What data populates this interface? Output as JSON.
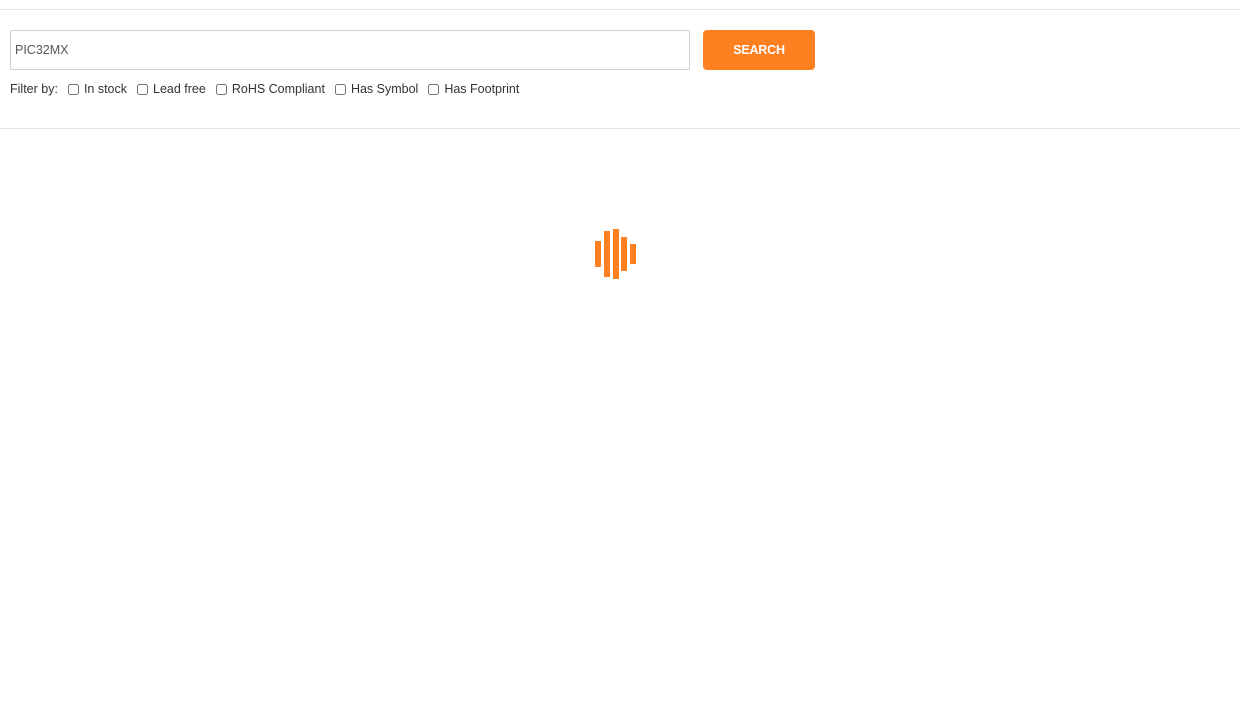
{
  "search": {
    "value": "PIC32MX",
    "placeholder": "",
    "button_label": "SEARCH"
  },
  "filters": {
    "label": "Filter by:",
    "options": [
      {
        "label": "In stock",
        "checked": false
      },
      {
        "label": "Lead free",
        "checked": false
      },
      {
        "label": "RoHS Compliant",
        "checked": false
      },
      {
        "label": "Has Symbol",
        "checked": false
      },
      {
        "label": "Has Footprint",
        "checked": false
      }
    ]
  },
  "loading": {
    "icon": "loading-bars-icon"
  },
  "colors": {
    "accent": "#ff8020",
    "divider": "#e3e3e3",
    "text": "#333333"
  }
}
